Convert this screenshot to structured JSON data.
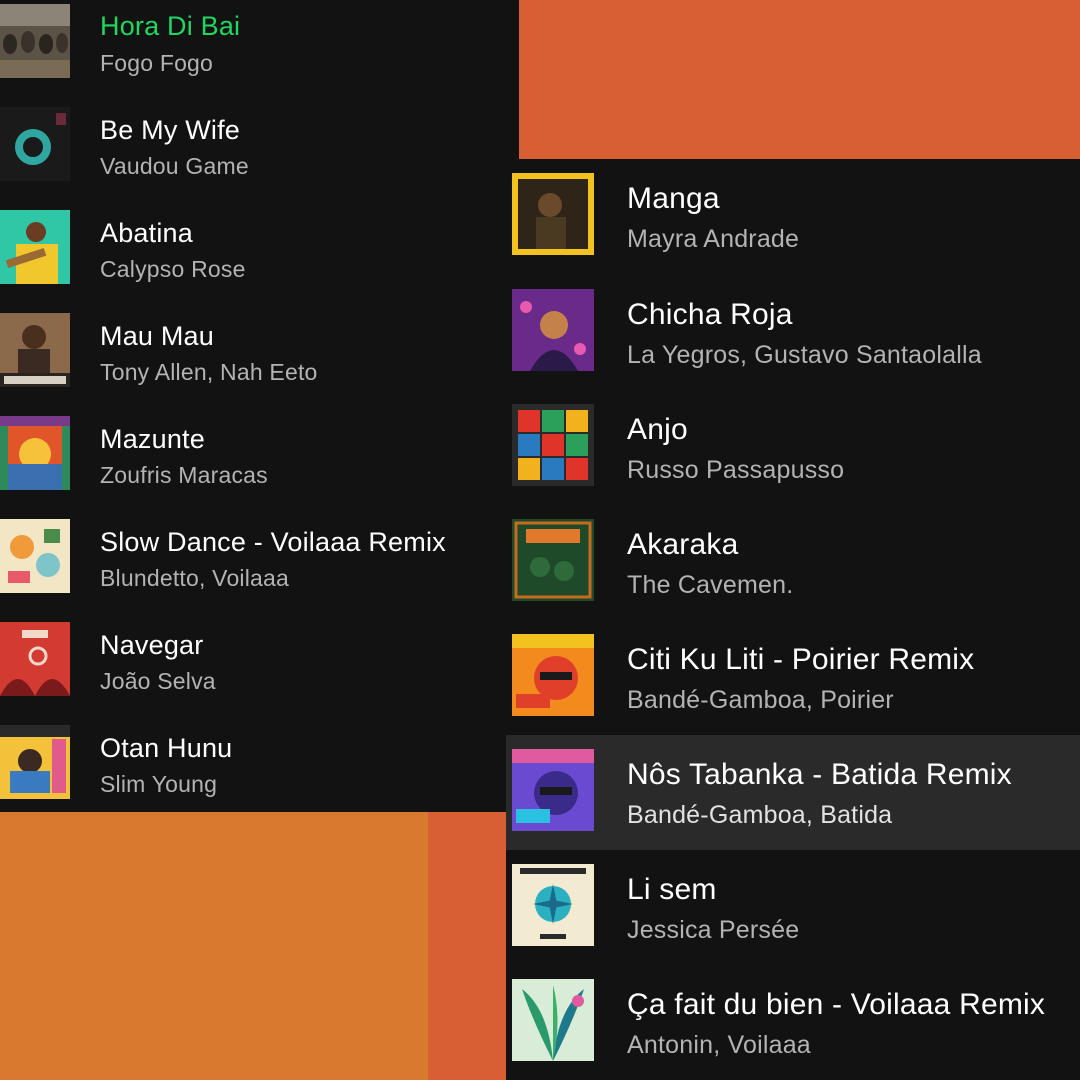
{
  "left_tracks": [
    {
      "title": "Hora Di Bai",
      "artist": "Fogo Fogo",
      "art": "album-art-fogo-fogo",
      "playing": true
    },
    {
      "title": "Be My Wife",
      "artist": "Vaudou Game",
      "art": "album-art-vaudou-game"
    },
    {
      "title": "Abatina",
      "artist": "Calypso Rose",
      "art": "album-art-calypso-rose"
    },
    {
      "title": "Mau Mau",
      "artist": "Tony Allen, Nah Eeto",
      "art": "album-art-tony-allen"
    },
    {
      "title": "Mazunte",
      "artist": "Zoufris Maracas",
      "art": "album-art-zoufris-maracas"
    },
    {
      "title": "Slow Dance - Voilaaa Remix",
      "artist": "Blundetto, Voilaaa",
      "art": "album-art-blundetto"
    },
    {
      "title": "Navegar",
      "artist": "João Selva",
      "art": "album-art-joao-selva"
    },
    {
      "title": "Otan Hunu",
      "artist": "Slim Young",
      "art": "album-art-slim-young"
    }
  ],
  "right_tracks": [
    {
      "title": "Manga",
      "artist": "Mayra Andrade",
      "art": "album-art-mayra-andrade"
    },
    {
      "title": "Chicha Roja",
      "artist": "La Yegros, Gustavo Santaolalla",
      "art": "album-art-la-yegros"
    },
    {
      "title": "Anjo",
      "artist": "Russo Passapusso",
      "art": "album-art-russo-passapusso"
    },
    {
      "title": "Akaraka",
      "artist": "The Cavemen.",
      "art": "album-art-the-cavemen"
    },
    {
      "title": "Citi Ku Liti - Poirier Remix",
      "artist": "Bandé-Gamboa, Poirier",
      "art": "album-art-bande-gamboa-poirier"
    },
    {
      "title": "Nôs Tabanka - Batida Remix",
      "artist": "Bandé-Gamboa, Batida",
      "art": "album-art-bande-gamboa-batida",
      "highlighted": true
    },
    {
      "title": "Li sem",
      "artist": "Jessica Persée",
      "art": "album-art-jessica-persee"
    },
    {
      "title": "Ça fait du bien - Voilaaa Remix",
      "artist": "Antonin, Voilaaa",
      "art": "album-art-antonin"
    }
  ],
  "colors": {
    "panel_bg": "#121212",
    "highlight_row": "#2a2a2a",
    "playing_green": "#1ed760",
    "artist_gray": "#b3b3b3",
    "bg_orange_red": "#d85e33",
    "bg_orange": "#d8792f"
  }
}
